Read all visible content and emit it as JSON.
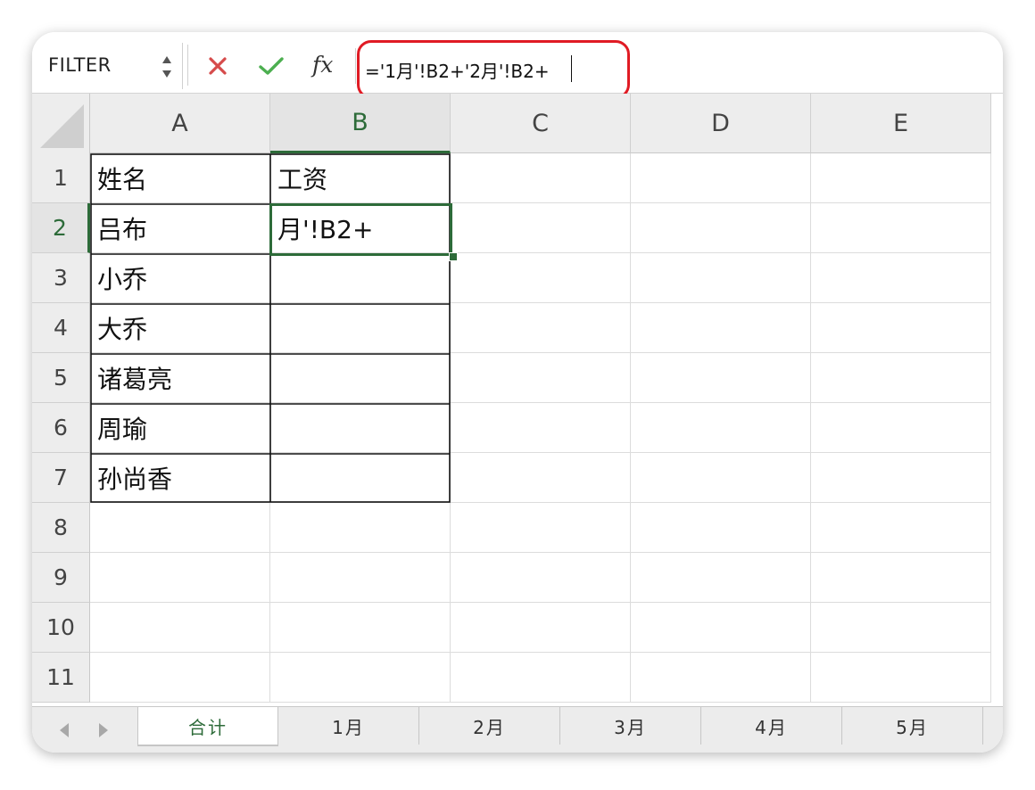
{
  "formula_bar": {
    "name_box": "FILTER",
    "cancel_icon": "x-icon",
    "confirm_icon": "check-icon",
    "fx_label": "fx",
    "formula": "='1月'!B2+'2月'!B2+"
  },
  "grid": {
    "columns": [
      "A",
      "B",
      "C",
      "D",
      "E"
    ],
    "active_column": "B",
    "rows": [
      "1",
      "2",
      "3",
      "4",
      "5",
      "6",
      "7",
      "8",
      "9",
      "10",
      "11"
    ],
    "active_row": "2",
    "cells": {
      "A1": "姓名",
      "B1": "工资",
      "A2": "吕布",
      "B2": "月'!B2+",
      "A3": "小乔",
      "A4": "大乔",
      "A5": "诸葛亮",
      "A6": "周瑜",
      "A7": "孙尚香"
    }
  },
  "sheet_tabs": {
    "tabs": [
      "合计",
      "1月",
      "2月",
      "3月",
      "4月",
      "5月"
    ],
    "active": "合计"
  },
  "colors": {
    "accent_green": "#2d6b39",
    "highlight_red": "#e01b24",
    "cancel_red": "#d64b4b",
    "confirm_green": "#4caf50"
  }
}
